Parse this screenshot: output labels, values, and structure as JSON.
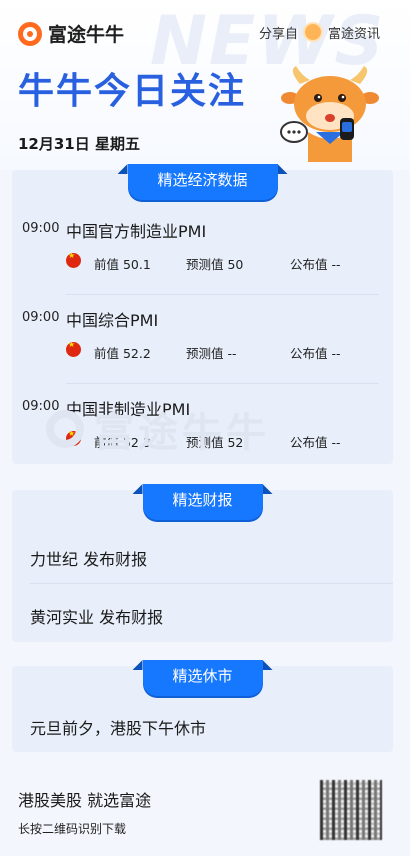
{
  "brand": {
    "logo_text": "富途牛牛",
    "share_prefix": "分享自",
    "share_source": "富途资讯",
    "bg_word": "NEWS"
  },
  "header": {
    "title": "牛牛今日关注",
    "date": "12月31日 星期五"
  },
  "econ": {
    "tab": "精选经济数据",
    "items": [
      {
        "time": "09:00",
        "title": "中国官方制造业PMI",
        "prev": "前值 50.1",
        "fcst": "预测值 50",
        "pub": "公布值 --"
      },
      {
        "time": "09:00",
        "title": "中国综合PMI",
        "prev": "前值 52.2",
        "fcst": "预测值 --",
        "pub": "公布值 --"
      },
      {
        "time": "09:00",
        "title": "中国非制造业PMI",
        "prev": "前值 52.3",
        "fcst": "预测值 52",
        "pub": "公布值 --"
      }
    ],
    "watermark": "富途牛牛"
  },
  "earnings": {
    "tab": "精选财报",
    "items": [
      "力世纪 发布财报",
      "黄河实业 发布财报"
    ]
  },
  "holiday": {
    "tab": "精选休市",
    "items": [
      "元旦前夕，港股下午休市"
    ]
  },
  "footer": {
    "title": "港股美股 就选富途",
    "subtitle": "长按二维码识别下载"
  },
  "colors": {
    "accent": "#1677ff",
    "title_blue": "#2860e0",
    "brand_orange": "#ff6a1f"
  }
}
